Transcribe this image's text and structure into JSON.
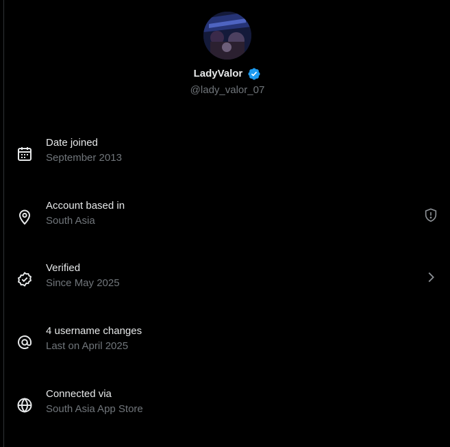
{
  "profile": {
    "display_name": "LadyValor",
    "handle": "@lady_valor_07",
    "verified": true,
    "verified_badge_color": "#1d9bf0"
  },
  "rows": [
    {
      "icon": "calendar-icon",
      "title": "Date joined",
      "subtitle": "September 2013"
    },
    {
      "icon": "location-pin-icon",
      "title": "Account based in",
      "subtitle": "South Asia",
      "action_icon": "shield-alert-icon"
    },
    {
      "icon": "verified-badge-outline-icon",
      "title": "Verified",
      "subtitle": "Since May 2025",
      "action_icon": "chevron-right-icon"
    },
    {
      "icon": "at-sign-icon",
      "title": "4 username changes",
      "subtitle": "Last on April 2025"
    },
    {
      "icon": "globe-icon",
      "title": "Connected via",
      "subtitle": "South Asia App Store"
    }
  ],
  "colors": {
    "background": "#000000",
    "primary_text": "#e7e9ea",
    "secondary_text": "#71767b",
    "accent": "#1d9bf0"
  }
}
